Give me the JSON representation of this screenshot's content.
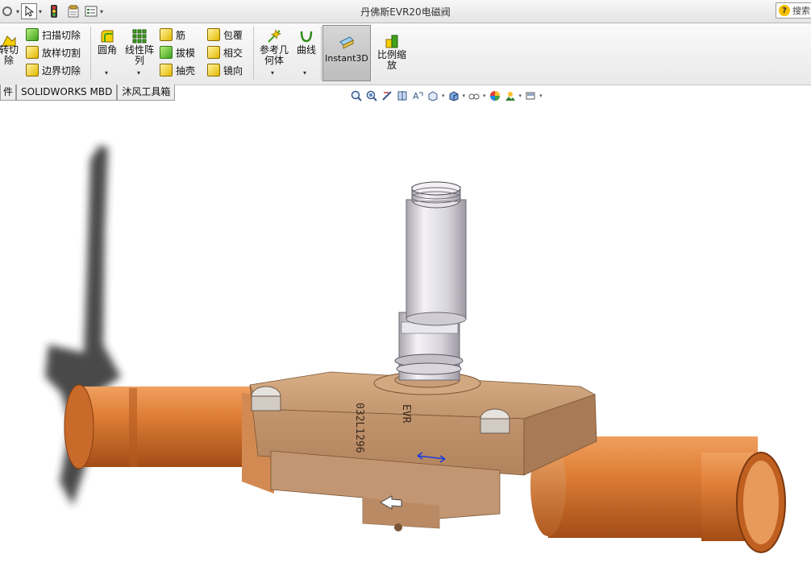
{
  "window": {
    "title": "丹佛斯EVR20电磁阀"
  },
  "help": {
    "search_label": "搜索"
  },
  "ribbon": {
    "revolve_cut_label": "转切\n除",
    "sweep_cut_label": "扫描切除",
    "loft_cut_label": "放样切割",
    "boundary_cut_label": "边界切除",
    "fillet_label": "圆角",
    "linear_pattern_label": "线性阵\n列",
    "rib_label": "筋",
    "draft_label": "拔模",
    "shell_label": "抽壳",
    "wrap_label": "包覆",
    "intersect_label": "相交",
    "mirror_label": "镜向",
    "ref_geometry_label": "参考几\n何体",
    "curves_label": "曲线",
    "instant3d_label": "Instant3D",
    "scale_label": "比例缩\n放"
  },
  "tabs": [
    {
      "label": "件"
    },
    {
      "label": "SOLIDWORKS MBD"
    },
    {
      "label": "沐风工具箱"
    }
  ],
  "model": {
    "body_marking": "032L1296",
    "brand_marking": "EVR"
  },
  "colors": {
    "copper": "#d9742f",
    "brass_body": "#c89b74",
    "plunger_tube": "#d8d6dc",
    "ribbon_bg": "#f1f1f1",
    "instant3d_active": "#c8c8c8"
  }
}
